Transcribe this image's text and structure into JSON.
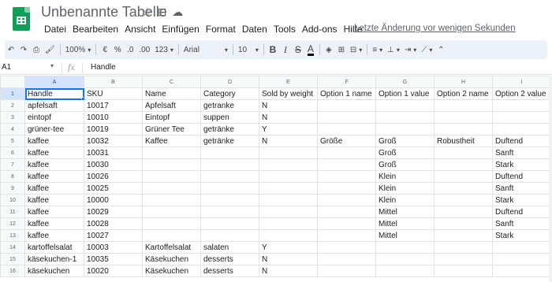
{
  "header": {
    "title": "Unbenannte Tabelle",
    "menu": [
      "Datei",
      "Bearbeiten",
      "Ansicht",
      "Einfügen",
      "Format",
      "Daten",
      "Tools",
      "Add-ons",
      "Hilfe"
    ],
    "last_edit": "Letzte Änderung vor wenigen Sekunden"
  },
  "toolbar": {
    "zoom": "100%",
    "currency": "€",
    "percent": "%",
    "dec_less": ".0",
    "dec_more": ".00",
    "more_formats": "123",
    "font": "Arial",
    "font_size": "10",
    "bold": "B",
    "italic": "I",
    "strike": "S",
    "text_color": "A"
  },
  "formula_bar": {
    "cell_ref": "A1",
    "fx": "fx",
    "content": "Handle"
  },
  "sheet": {
    "columns": [
      "A",
      "B",
      "C",
      "D",
      "E",
      "F",
      "G",
      "H",
      "I"
    ],
    "rows": [
      {
        "n": "1",
        "cells": [
          "Handle",
          "SKU",
          "Name",
          "Category",
          "Sold by weight",
          "Option 1 name",
          "Option 1 value",
          "Option 2 name",
          "Option 2 value"
        ]
      },
      {
        "n": "2",
        "cells": [
          "apfelsaft",
          "10017",
          "Apfelsaft",
          "getranke",
          "N",
          "",
          "",
          "",
          ""
        ]
      },
      {
        "n": "3",
        "cells": [
          "eintopf",
          "10010",
          "Eintopf",
          "suppen",
          "N",
          "",
          "",
          "",
          ""
        ]
      },
      {
        "n": "4",
        "cells": [
          "grüner-tee",
          "10019",
          "Grüner Tee",
          "getränke",
          "Y",
          "",
          "",
          "",
          ""
        ]
      },
      {
        "n": "5",
        "cells": [
          "kaffee",
          "10032",
          "Kaffee",
          "getränke",
          "N",
          "Größe",
          "Groß",
          "Robustheit",
          "Duftend"
        ]
      },
      {
        "n": "6",
        "cells": [
          "kaffee",
          "10031",
          "",
          "",
          "",
          "",
          "Groß",
          "",
          "Sanft"
        ]
      },
      {
        "n": "7",
        "cells": [
          "kaffee",
          "10030",
          "",
          "",
          "",
          "",
          "Groß",
          "",
          "Stark"
        ]
      },
      {
        "n": "8",
        "cells": [
          "kaffee",
          "10026",
          "",
          "",
          "",
          "",
          "Klein",
          "",
          "Duftend"
        ]
      },
      {
        "n": "9",
        "cells": [
          "kaffee",
          "10025",
          "",
          "",
          "",
          "",
          "Klein",
          "",
          "Sanft"
        ]
      },
      {
        "n": "10",
        "cells": [
          "kaffee",
          "10000",
          "",
          "",
          "",
          "",
          "Klein",
          "",
          "Stark"
        ]
      },
      {
        "n": "11",
        "cells": [
          "kaffee",
          "10029",
          "",
          "",
          "",
          "",
          "Mittel",
          "",
          "Duftend"
        ]
      },
      {
        "n": "12",
        "cells": [
          "kaffee",
          "10028",
          "",
          "",
          "",
          "",
          "Mittel",
          "",
          "Sanft"
        ]
      },
      {
        "n": "13",
        "cells": [
          "kaffee",
          "10027",
          "",
          "",
          "",
          "",
          "Mittel",
          "",
          "Stark"
        ]
      },
      {
        "n": "14",
        "cells": [
          "kartoffelsalat",
          "10003",
          "Kartoffelsalat",
          "salaten",
          "Y",
          "",
          "",
          "",
          ""
        ]
      },
      {
        "n": "15",
        "cells": [
          "käsekuchen-1",
          "10035",
          "Käsekuchen",
          "desserts",
          "N",
          "",
          "",
          "",
          ""
        ]
      },
      {
        "n": "16",
        "cells": [
          "käsekuchen",
          "10020",
          "Käsekuchen",
          "desserts",
          "N",
          "",
          "",
          "",
          ""
        ]
      }
    ]
  },
  "colors": {
    "brand": "#0f9d58",
    "toolbar_bg": "#edf2fa",
    "selection": "#1a73e8"
  }
}
